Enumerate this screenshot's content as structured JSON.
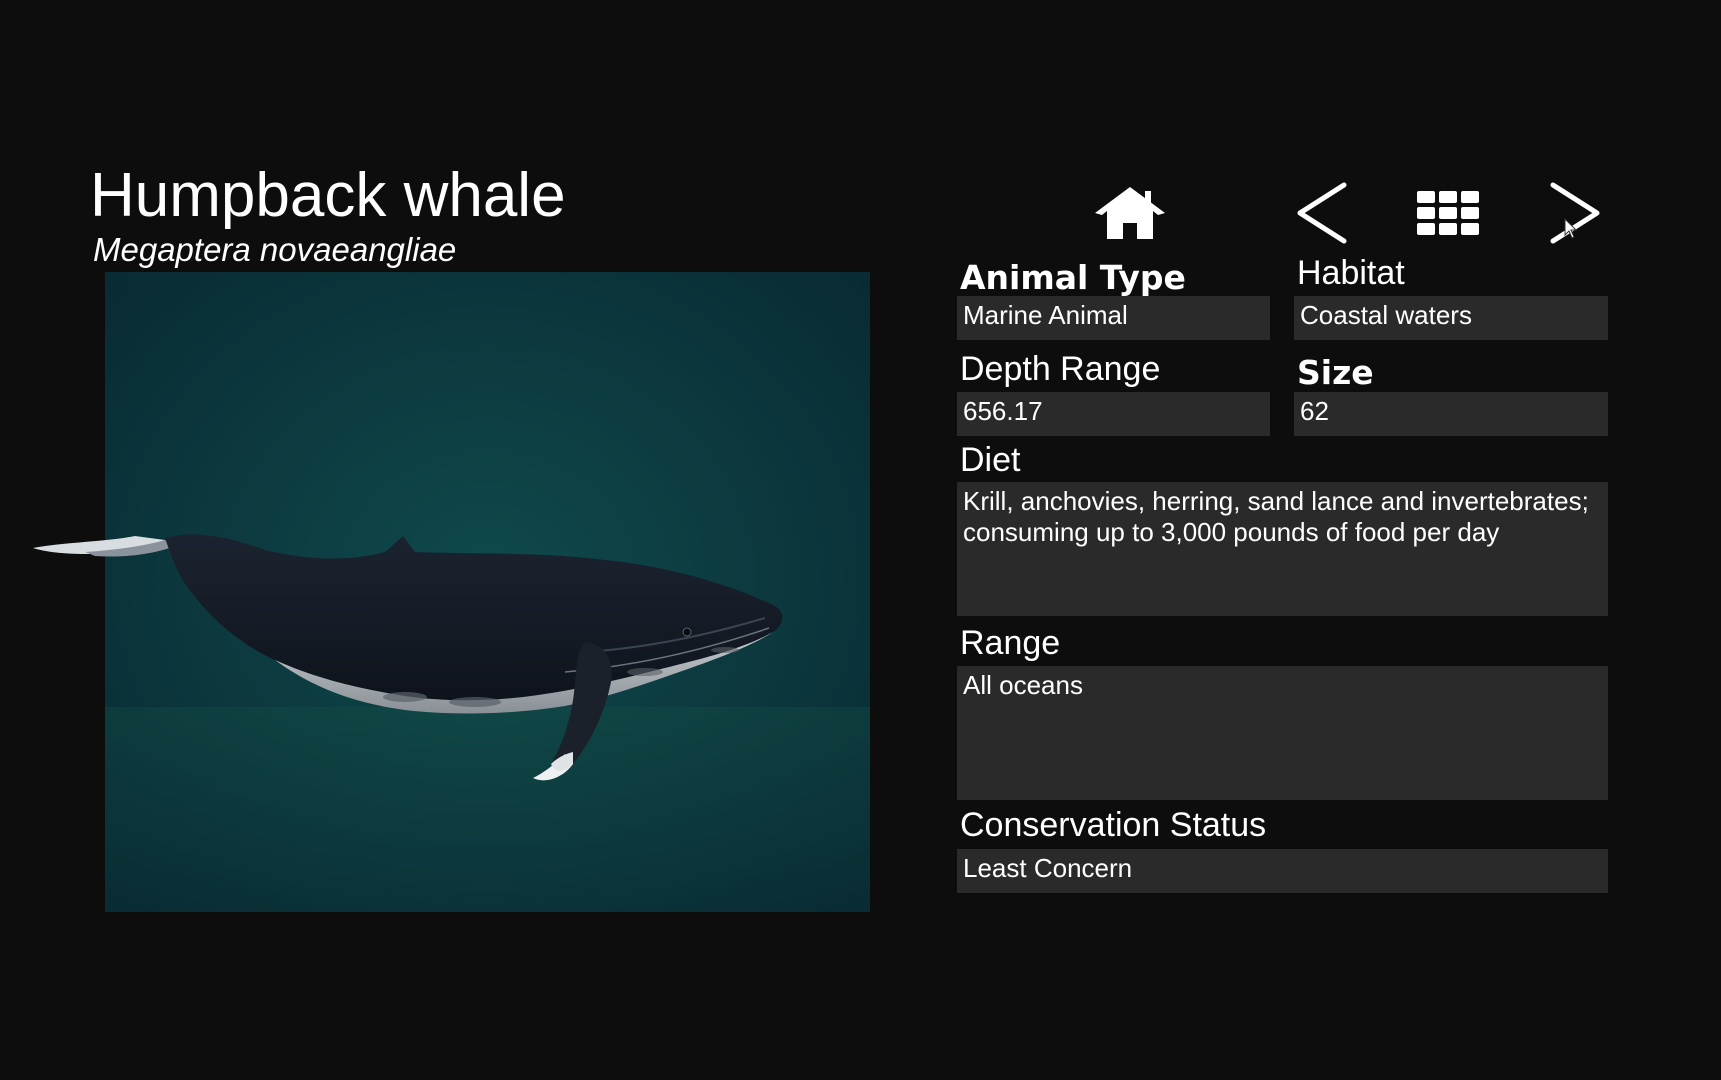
{
  "header": {
    "common_name": "Humpback whale",
    "scientific_name": "Megaptera novaeangliae"
  },
  "viewer": {
    "background_color": "#0c3b40",
    "model": "humpback-whale-3d"
  },
  "nav": {
    "home_icon": "home-icon",
    "prev_icon": "chevron-left-icon",
    "grid_icon": "grid-icon",
    "next_icon": "chevron-right-icon"
  },
  "fields": {
    "animal_type": {
      "label": "Animal Type",
      "value": "Marine Animal"
    },
    "habitat": {
      "label": "Habitat",
      "value": "Coastal waters"
    },
    "depth_range": {
      "label": "Depth Range",
      "value": "656.17"
    },
    "size": {
      "label": "Size",
      "value": "62"
    },
    "diet": {
      "label": "Diet",
      "value": "Krill, anchovies, herring, sand lance and invertebrates; consuming up to 3,000 pounds of food per day"
    },
    "range": {
      "label": "Range",
      "value": "All oceans"
    },
    "conservation_status": {
      "label": "Conservation Status",
      "value": "Least Concern"
    }
  },
  "colors": {
    "background": "#0d0d0d",
    "field_background": "#2a2a2a",
    "text": "#ffffff"
  }
}
